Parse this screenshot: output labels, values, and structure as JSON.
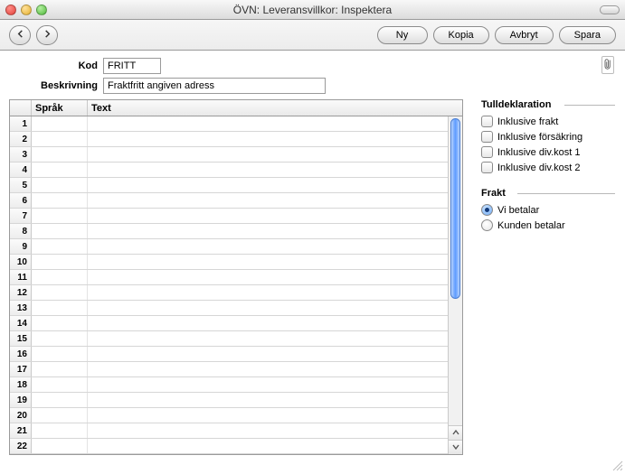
{
  "window": {
    "title": "ÖVN: Leveransvillkor: Inspektera"
  },
  "toolbar": {
    "ny": "Ny",
    "kopia": "Kopia",
    "avbryt": "Avbryt",
    "spara": "Spara"
  },
  "form": {
    "kod_label": "Kod",
    "kod_value": "FRITT",
    "beskrivning_label": "Beskrivning",
    "beskrivning_value": "Fraktfritt angiven adress"
  },
  "table": {
    "headers": {
      "sprak": "Språk",
      "text": "Text"
    },
    "rows": [
      {
        "n": "1",
        "sprak": "",
        "text": ""
      },
      {
        "n": "2",
        "sprak": "",
        "text": ""
      },
      {
        "n": "3",
        "sprak": "",
        "text": ""
      },
      {
        "n": "4",
        "sprak": "",
        "text": ""
      },
      {
        "n": "5",
        "sprak": "",
        "text": ""
      },
      {
        "n": "6",
        "sprak": "",
        "text": ""
      },
      {
        "n": "7",
        "sprak": "",
        "text": ""
      },
      {
        "n": "8",
        "sprak": "",
        "text": ""
      },
      {
        "n": "9",
        "sprak": "",
        "text": ""
      },
      {
        "n": "10",
        "sprak": "",
        "text": ""
      },
      {
        "n": "11",
        "sprak": "",
        "text": ""
      },
      {
        "n": "12",
        "sprak": "",
        "text": ""
      },
      {
        "n": "13",
        "sprak": "",
        "text": ""
      },
      {
        "n": "14",
        "sprak": "",
        "text": ""
      },
      {
        "n": "15",
        "sprak": "",
        "text": ""
      },
      {
        "n": "16",
        "sprak": "",
        "text": ""
      },
      {
        "n": "17",
        "sprak": "",
        "text": ""
      },
      {
        "n": "18",
        "sprak": "",
        "text": ""
      },
      {
        "n": "19",
        "sprak": "",
        "text": ""
      },
      {
        "n": "20",
        "sprak": "",
        "text": ""
      },
      {
        "n": "21",
        "sprak": "",
        "text": ""
      },
      {
        "n": "22",
        "sprak": "",
        "text": ""
      }
    ]
  },
  "side": {
    "tulldeklaration": {
      "title": "Tulldeklaration",
      "items": [
        {
          "label": "Inklusive frakt",
          "checked": false
        },
        {
          "label": "Inklusive försäkring",
          "checked": false
        },
        {
          "label": "Inklusive div.kost 1",
          "checked": false
        },
        {
          "label": "Inklusive div.kost 2",
          "checked": false
        }
      ]
    },
    "frakt": {
      "title": "Frakt",
      "options": [
        {
          "label": "Vi betalar",
          "selected": true
        },
        {
          "label": "Kunden betalar",
          "selected": false
        }
      ]
    }
  }
}
